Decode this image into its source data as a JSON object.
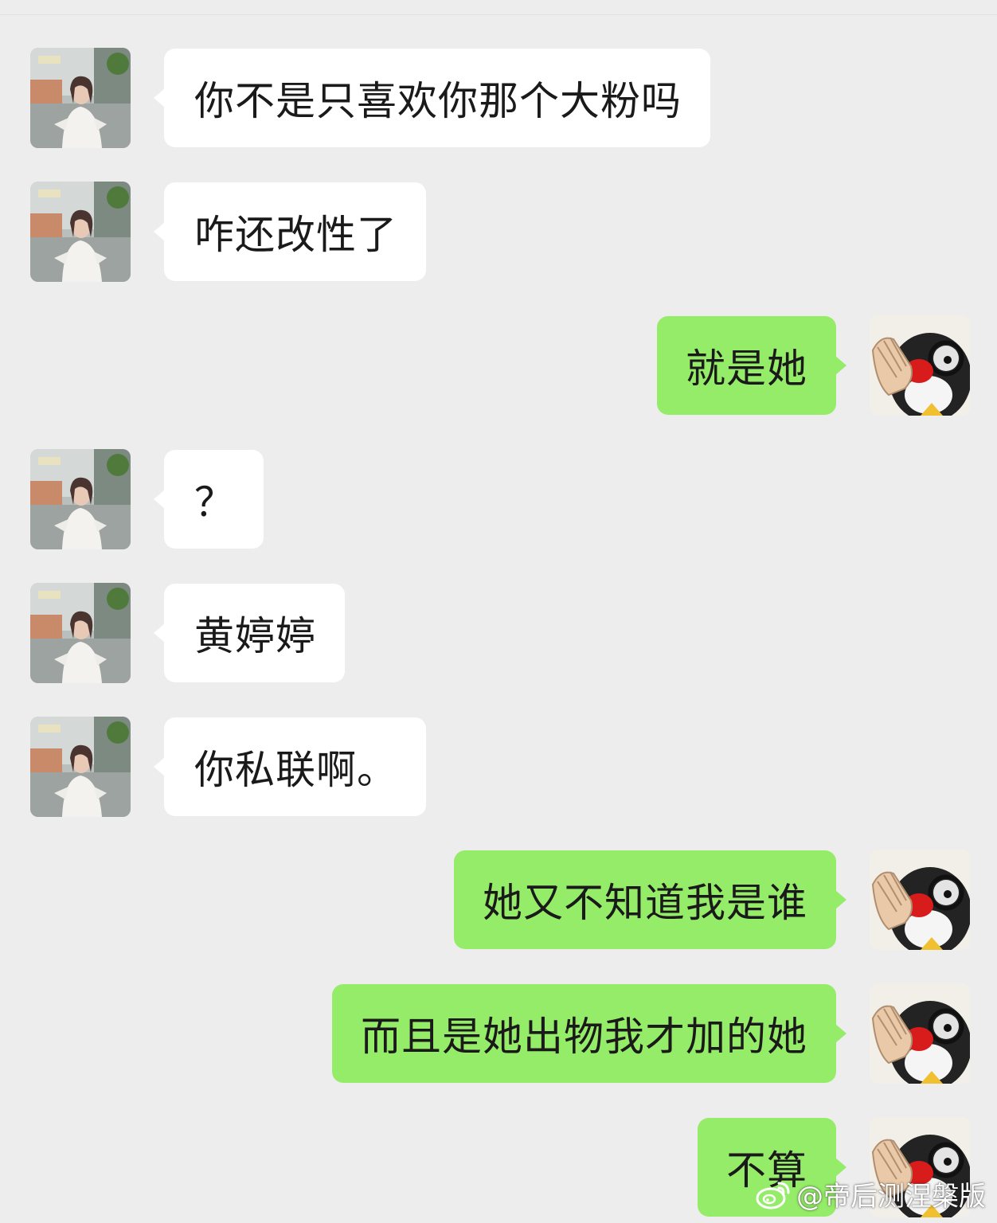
{
  "messages": [
    {
      "side": "in",
      "text": "你不是只喜欢你那个大粉吗"
    },
    {
      "side": "in",
      "text": "咋还改性了"
    },
    {
      "side": "out",
      "text": "就是她"
    },
    {
      "side": "in",
      "text": "？"
    },
    {
      "side": "in",
      "text": "黄婷婷"
    },
    {
      "side": "in",
      "text": "你私联啊。"
    },
    {
      "side": "out",
      "text": "她又不知道我是谁"
    },
    {
      "side": "out",
      "text": "而且是她出物我才加的她"
    },
    {
      "side": "out",
      "text": "不算"
    }
  ],
  "watermark": {
    "text": "@帝后测涅槃版",
    "icon": "weibo-icon"
  },
  "colors": {
    "background": "#ededed",
    "incoming_bubble": "#ffffff",
    "outgoing_bubble": "#95ec69"
  }
}
